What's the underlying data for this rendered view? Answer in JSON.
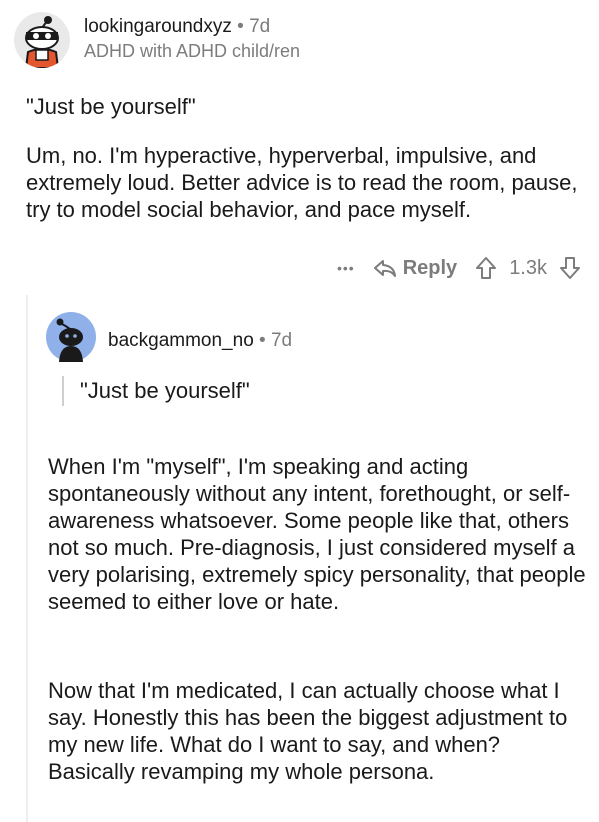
{
  "comment1": {
    "username": "lookingaroundxyz",
    "separator": "•",
    "age": "7d",
    "flair": "ADHD with ADHD child/ren",
    "quote": "\"Just be yourself\"",
    "body": "Um, no. I'm hyperactive, hyperverbal, impulsive, and extremely loud. Better advice is to read the room, pause, try to model social behavior, and pace myself.",
    "actions": {
      "more": "•••",
      "reply": "Reply",
      "score": "1.3k"
    }
  },
  "comment2": {
    "username": "backgammon_no",
    "separator": "•",
    "age": "7d",
    "quote": "\"Just be yourself\"",
    "para1": "When I'm \"myself\", I'm speaking and acting spontaneously without any intent, forethought, or self-awareness whatsoever. Some people like that, others not so much. Pre-diagnosis, I just considered myself a very polarising, extremely spicy personality, that people seemed to either love or hate.",
    "para2": "Now that I'm medicated, I can actually choose what I say. Honestly this has been the biggest adjustment to my new life. What do I want to say, and when? Basically revamping my whole persona."
  },
  "colors": {
    "meta_gray": "#7c7c7c",
    "text": "#1a1a1b",
    "avatar_blue": "#8fb0e8"
  },
  "icons": [
    "snoo-avatar-icon",
    "reply-arrow-icon",
    "upvote-icon",
    "downvote-icon",
    "more-dots-icon"
  ]
}
